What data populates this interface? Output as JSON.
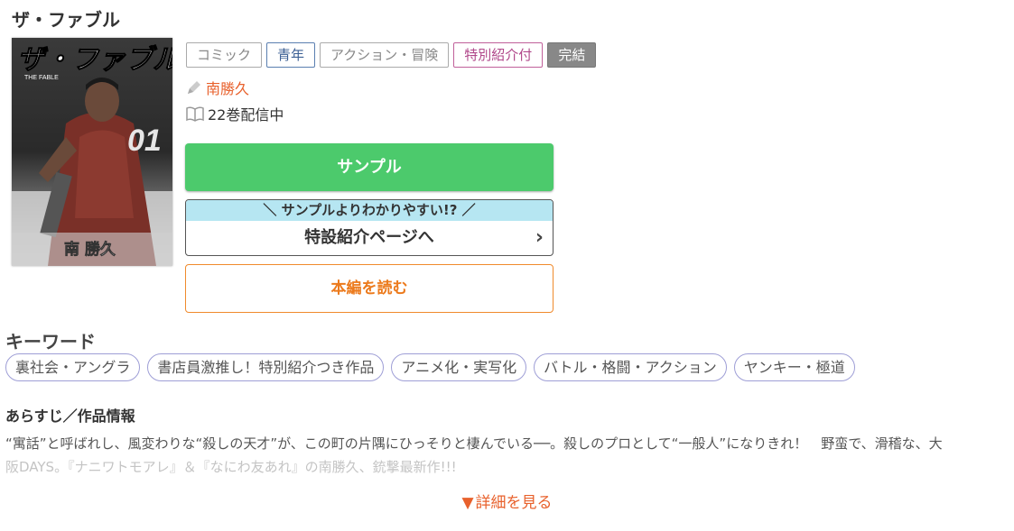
{
  "title": "ザ・ファブル",
  "cover": {
    "title_logo": "ザ・ファブル",
    "subtitle": "THE FABLE",
    "volume": "01",
    "author": "南 勝久"
  },
  "tags": [
    {
      "label": "コミック",
      "style": "gray"
    },
    {
      "label": "青年",
      "style": "blue"
    },
    {
      "label": "アクション・冒険",
      "style": "gray"
    },
    {
      "label": "特別紹介付",
      "style": "pink"
    },
    {
      "label": "完結",
      "style": "done"
    }
  ],
  "author": "南勝久",
  "volumes": "22巻配信中",
  "buttons": {
    "sample": "サンプル",
    "special_banner": "＼ サンプルよりわかりやすい!? ／",
    "special_main": "特設紹介ページへ",
    "read": "本編を読む"
  },
  "keywords_title": "キーワード",
  "keywords": [
    "裏社会・アングラ",
    "書店員激推し！特別紹介つき作品",
    "アニメ化・実写化",
    "バトル・格闘・アクション",
    "ヤンキー・極道"
  ],
  "synopsis_title": "あらすじ／作品情報",
  "synopsis_line1": "“寓話”と呼ばれし、風変わりな“殺しの天才”が、この町の片隅にひっそりと棲んでいる──。殺しのプロとして“一般人”になりきれ！　野蛮で、滑稽な、大",
  "synopsis_line2": "阪DAYS。『ナニワトモアレ』＆『なにわ友あれ』の南勝久、銃撃最新作!!!",
  "more": "詳細を見る",
  "colors": {
    "accent": "#e8612c",
    "sample_green": "#4cca6c",
    "read_orange": "#f08a2c",
    "banner_blue": "#b6e6f2"
  }
}
